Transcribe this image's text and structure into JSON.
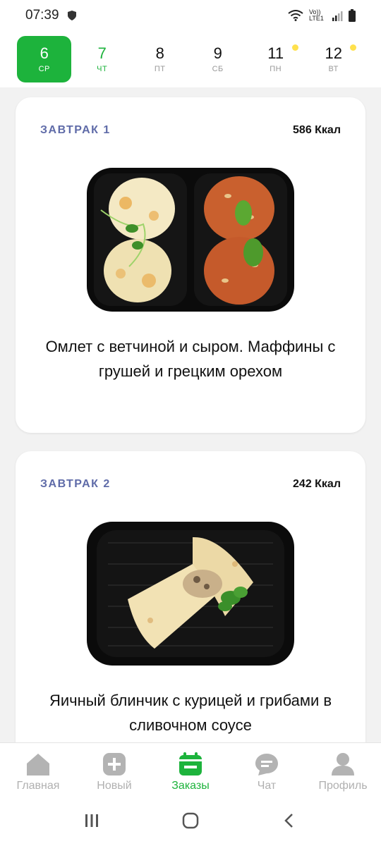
{
  "status_bar": {
    "time": "07:39",
    "network_label": "Vo)) LTE1"
  },
  "dates": [
    {
      "num": "6",
      "dow": "СР",
      "state": "active",
      "dot": false
    },
    {
      "num": "7",
      "dow": "ЧТ",
      "state": "green",
      "dot": false
    },
    {
      "num": "8",
      "dow": "ПТ",
      "state": "normal",
      "dot": false
    },
    {
      "num": "9",
      "dow": "СБ",
      "state": "normal",
      "dot": false
    },
    {
      "num": "11",
      "dow": "ПН",
      "state": "normal",
      "dot": true
    },
    {
      "num": "12",
      "dow": "ВТ",
      "state": "normal",
      "dot": true
    }
  ],
  "meals": [
    {
      "name": "ЗАВТРАК 1",
      "kcal": "586 Ккал",
      "description": "Омлет с ветчиной и сыром. Маффины с грушей и грецким орехом"
    },
    {
      "name": "ЗАВТРАК 2",
      "kcal": "242 Ккал",
      "description": "Яичный блинчик с курицей и грибами в сливочном соусе"
    }
  ],
  "bottom_nav": [
    {
      "label": "Главная",
      "icon": "home-icon"
    },
    {
      "label": "Новый",
      "icon": "plus-icon"
    },
    {
      "label": "Заказы",
      "icon": "calendar-icon",
      "active": true
    },
    {
      "label": "Чат",
      "icon": "chat-icon"
    },
    {
      "label": "Профиль",
      "icon": "profile-icon"
    }
  ],
  "colors": {
    "accent": "#1db33c",
    "meal_title": "#5f6ba8",
    "dot": "#ffe14d"
  }
}
